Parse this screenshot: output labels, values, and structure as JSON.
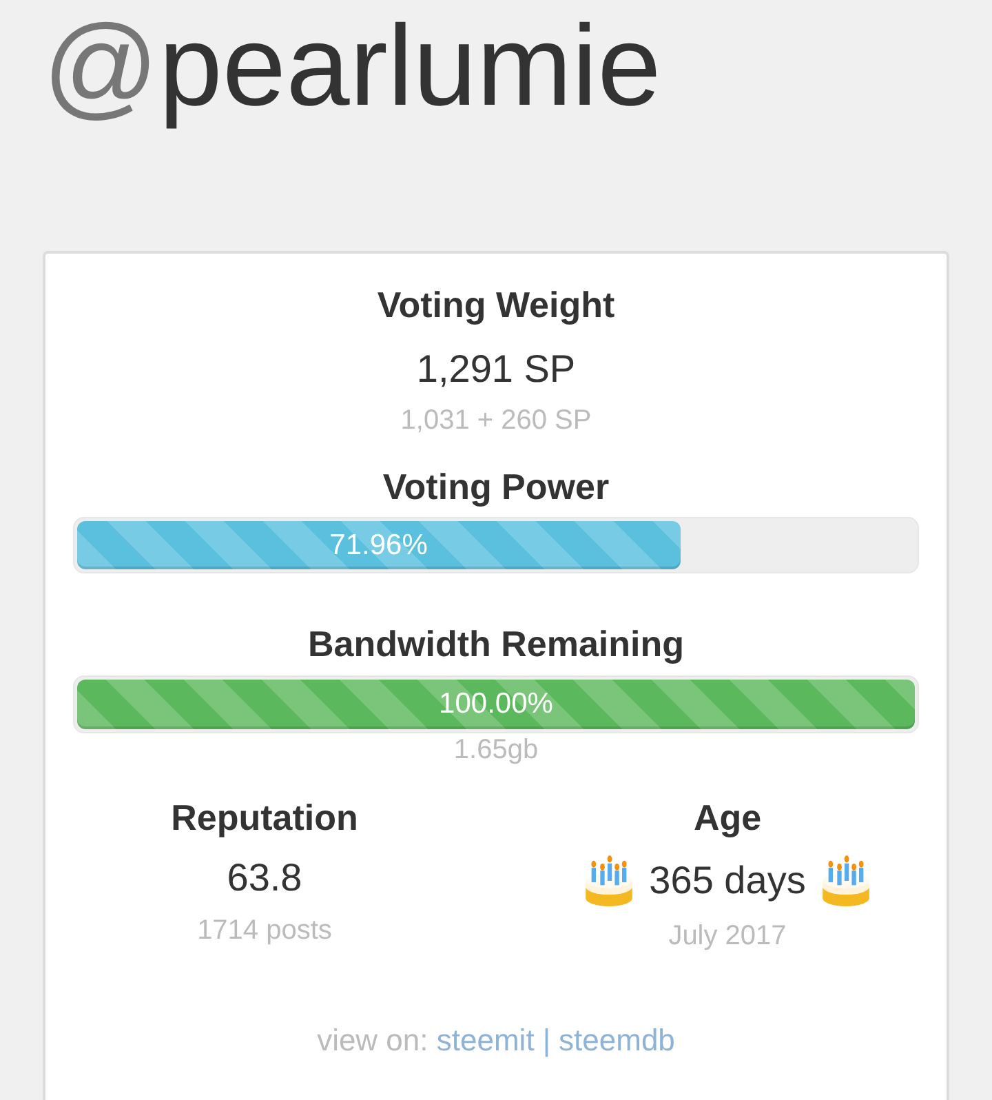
{
  "username": {
    "prefix": "@",
    "name": "pearlumie"
  },
  "voting_weight": {
    "label": "Voting Weight",
    "value": "1,291 SP",
    "breakdown": "1,031 + 260 SP"
  },
  "meters": [
    {
      "label": "Voting Power",
      "level": 0.7196,
      "reading": "71.96%",
      "color": "#5bc0de"
    },
    {
      "label": "Bandwidth Remaining",
      "level": 1.0,
      "reading": "100.00%",
      "color": "#5cb85c",
      "detail": "1.65gb"
    }
  ],
  "stats": [
    {
      "kind": "plain",
      "label": "Reputation",
      "value": "63.8",
      "detail": "1714 posts"
    },
    {
      "kind": "birthday",
      "label": "Age",
      "value": "365 days",
      "detail": "July 2017"
    }
  ],
  "view_on": {
    "label": "view on:",
    "links": [
      "steemit",
      "steemdb"
    ],
    "separator": "|"
  }
}
